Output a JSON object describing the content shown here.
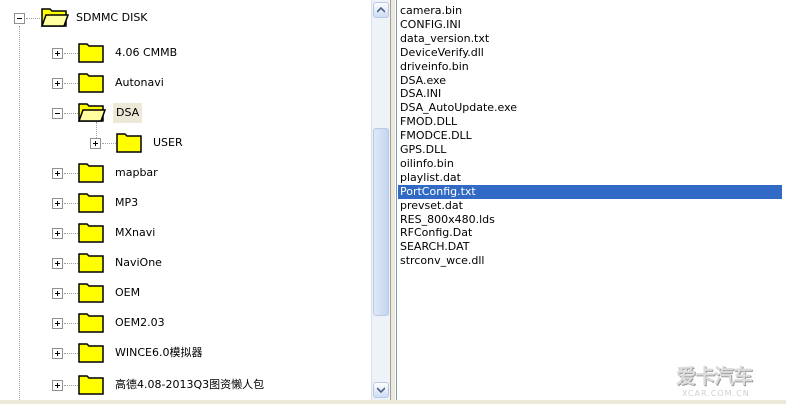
{
  "tree": {
    "root": {
      "label": "SDMMC DISK",
      "icon": "folder-open-icon",
      "expanded": true
    },
    "items": [
      {
        "label": "4.06 CMMB",
        "icon": "folder-icon",
        "expanded": false
      },
      {
        "label": "Autonavi",
        "icon": "folder-icon",
        "expanded": false
      },
      {
        "label": "DSA",
        "icon": "folder-open-icon",
        "expanded": true,
        "highlighted": true,
        "children": [
          {
            "label": "USER",
            "icon": "folder-icon",
            "expanded": false
          }
        ]
      },
      {
        "label": "mapbar",
        "icon": "folder-icon",
        "expanded": false
      },
      {
        "label": "MP3",
        "icon": "folder-icon",
        "expanded": false
      },
      {
        "label": "MXnavi",
        "icon": "folder-icon",
        "expanded": false
      },
      {
        "label": "NaviOne",
        "icon": "folder-icon",
        "expanded": false
      },
      {
        "label": "OEM",
        "icon": "folder-icon",
        "expanded": false
      },
      {
        "label": "OEM2.03",
        "icon": "folder-icon",
        "expanded": false
      },
      {
        "label": "WINCE6.0模拟器",
        "icon": "folder-icon",
        "expanded": false
      },
      {
        "label": "高德4.08-2013Q3图资懒人包",
        "icon": "folder-icon",
        "expanded": false
      }
    ]
  },
  "files": [
    "camera.bin",
    "CONFIG.INI",
    "data_version.txt",
    "DeviceVerify.dll",
    "driveinfo.bin",
    "DSA.exe",
    "DSA.INI",
    "DSA_AutoUpdate.exe",
    "FMOD.DLL",
    "FMODCE.DLL",
    "GPS.DLL",
    "oilinfo.bin",
    "playlist.dat",
    "PortConfig.txt",
    "prevset.dat",
    "RES_800x480.lds",
    "RFConfig.Dat",
    "SEARCH.DAT",
    "strconv_wce.dll"
  ],
  "selected_file": "PortConfig.txt",
  "watermark": {
    "main": "爱卡汽车",
    "sub": "XCAR.COM.CN"
  },
  "colors": {
    "selection": "#316ac5",
    "folder_yellow": "#ffff00",
    "highlight_bg": "#ece9d8"
  }
}
